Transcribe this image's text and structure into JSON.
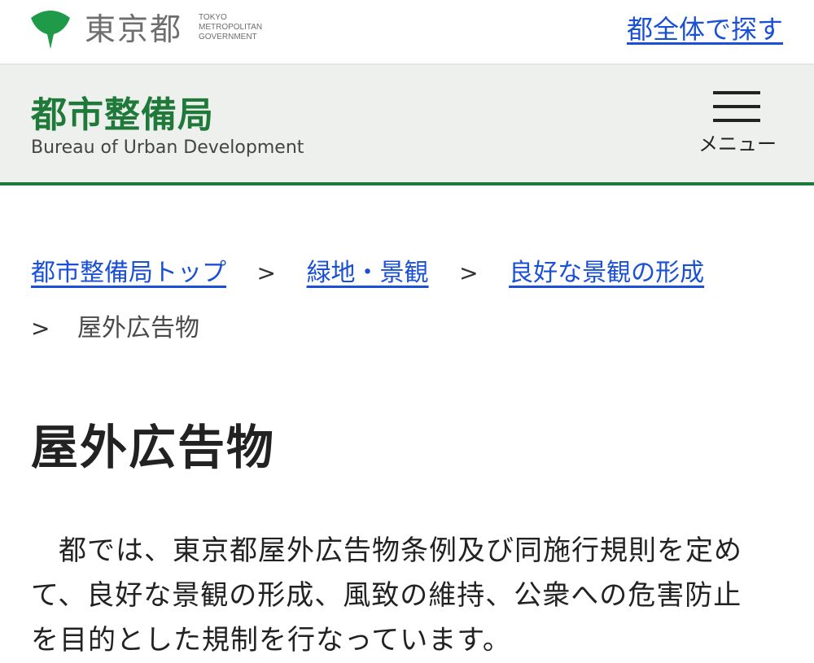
{
  "header": {
    "org_name": "東京都",
    "org_name_en": [
      "TOKYO",
      "METROPOLITAN",
      "GOVERNMENT"
    ],
    "search_all_link": "都全体で探す",
    "brand_color": "#1f7a3a",
    "link_color": "#1a50d6"
  },
  "bureau": {
    "name": "都市整備局",
    "name_en": "Bureau of Urban Development",
    "menu_icon": "hamburger-icon",
    "menu_label": "メニュー"
  },
  "breadcrumb": {
    "items": [
      {
        "label": "都市整備局トップ"
      },
      {
        "label": "緑地・景観"
      },
      {
        "label": "良好な景観の形成"
      },
      {
        "label": "屋外広告物"
      }
    ],
    "separator": ">"
  },
  "main": {
    "title": "屋外広告物",
    "body": "都では、東京都屋外広告物条例及び同施行規則を定めて、良好な景観の形成、風致の維持、公衆への危害防止を目的とした規制を行なっています。"
  }
}
